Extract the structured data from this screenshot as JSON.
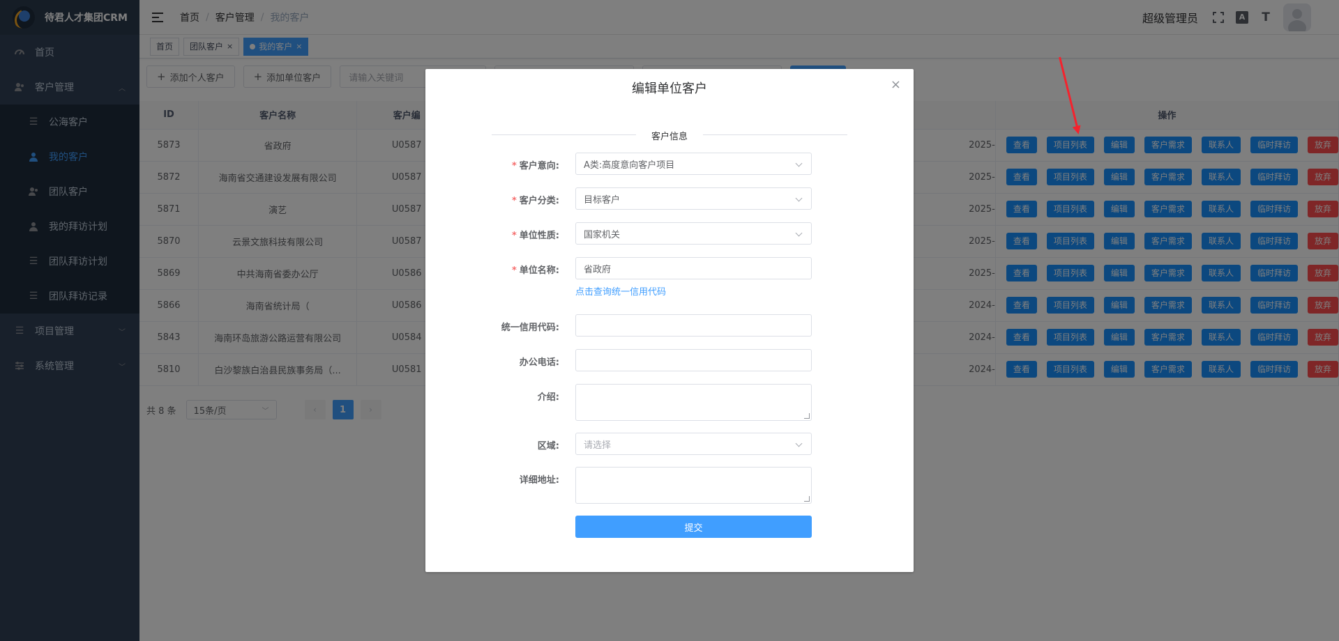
{
  "sidebar": {
    "logo_text": "待君人才集团CRM",
    "items": [
      {
        "label": "首页",
        "icon": "dashboard-icon"
      },
      {
        "label": "客户管理",
        "icon": "customer-icon",
        "expanded": true
      },
      {
        "label": "项目管理",
        "icon": "list-icon"
      },
      {
        "label": "系统管理",
        "icon": "settings-sliders-icon"
      }
    ],
    "customer_submenu": [
      {
        "label": "公海客户",
        "icon": "list-icon"
      },
      {
        "label": "我的客户",
        "icon": "user-icon",
        "active": true
      },
      {
        "label": "团队客户",
        "icon": "team-icon"
      },
      {
        "label": "我的拜访计划",
        "icon": "user-icon"
      },
      {
        "label": "团队拜访计划",
        "icon": "list-icon"
      },
      {
        "label": "团队拜访记录",
        "icon": "list-icon"
      }
    ]
  },
  "navbar": {
    "breadcrumb": [
      "首页",
      "客户管理",
      "我的客户"
    ],
    "breadcrumb_sep": "/",
    "user_name": "超级管理员",
    "font_icon_label": "A",
    "text_size_icon_label": "T"
  },
  "tags": [
    {
      "label": "首页"
    },
    {
      "label": "团队客户",
      "close": "×"
    },
    {
      "label": "我的客户",
      "close": "×",
      "active": true
    }
  ],
  "toolbar": {
    "add_personal": "添加个人客户",
    "add_unit": "添加单位客户",
    "keyword_placeholder": "请输入关键词"
  },
  "table": {
    "headers": [
      "ID",
      "客户名称",
      "客户编",
      "操作"
    ],
    "rows": [
      {
        "id": "5873",
        "name": "省政府",
        "code": "U0587",
        "date": "2025-"
      },
      {
        "id": "5872",
        "name": "海南省交通建设发展有限公司",
        "code": "U0587",
        "date": "2025-"
      },
      {
        "id": "5871",
        "name": "演艺",
        "code": "U0587",
        "date": "2025-"
      },
      {
        "id": "5870",
        "name": "云景文旅科技有限公司",
        "code": "U0587",
        "date": "2025-"
      },
      {
        "id": "5869",
        "name": "中共海南省委办公厅",
        "code": "U0586",
        "date": "2025-"
      },
      {
        "id": "5866",
        "name": "海南省统计局（",
        "code": "U0586",
        "date": "2024-"
      },
      {
        "id": "5843",
        "name": "海南环岛旅游公路运营有限公司",
        "code": "U0584",
        "date": "2024-"
      },
      {
        "id": "5810",
        "name": "白沙黎族白治县民族事务局（...",
        "code": "U0581",
        "date": "2024-"
      }
    ],
    "ops": [
      "查看",
      "项目列表",
      "编辑",
      "客户需求",
      "联系人",
      "临时拜访",
      "放弃"
    ]
  },
  "pager": {
    "total": "共 8 条",
    "page_size": "15条/页",
    "current": "1",
    "prev": "‹",
    "next": "›"
  },
  "dialog": {
    "title": "编辑单位客户",
    "close": "×",
    "section": "客户信息",
    "fields": {
      "intent_label": "客户意向:",
      "intent_value": "A类:高度意向客户项目",
      "category_label": "客户分类:",
      "category_value": "目标客户",
      "nature_label": "单位性质:",
      "nature_value": "国家机关",
      "unit_name_label": "单位名称:",
      "unit_name_value": "省政府",
      "credit_link": "点击查询统一信用代码",
      "credit_label": "统一信用代码:",
      "credit_value": "",
      "phone_label": "办公电话:",
      "phone_value": "",
      "intro_label": "介绍:",
      "intro_value": "",
      "region_label": "区域:",
      "region_placeholder": "请选择",
      "address_label": "详细地址:",
      "address_value": ""
    },
    "required_mark": "*",
    "submit": "提交"
  },
  "colors": {
    "sidebar_bg": "#304156",
    "primary": "#409eff",
    "danger": "#ff4d4f",
    "annotation": "#f5222d"
  }
}
